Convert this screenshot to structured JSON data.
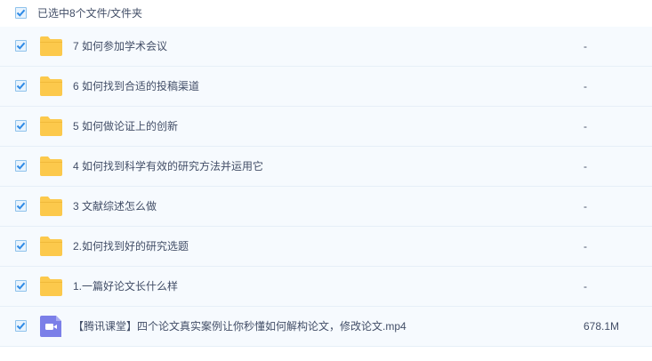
{
  "header": {
    "label": "已选中8个文件/文件夹",
    "checked": true
  },
  "items": [
    {
      "type": "folder",
      "name": "7 如何参加学术会议",
      "size": "-",
      "checked": true
    },
    {
      "type": "folder",
      "name": "6 如何找到合适的投稿渠道",
      "size": "-",
      "checked": true
    },
    {
      "type": "folder",
      "name": "5 如何做论证上的创新",
      "size": "-",
      "checked": true
    },
    {
      "type": "folder",
      "name": "4 如何找到科学有效的研究方法并运用它",
      "size": "-",
      "checked": true
    },
    {
      "type": "folder",
      "name": "3 文献综述怎么做",
      "size": "-",
      "checked": true
    },
    {
      "type": "folder",
      "name": "2.如何找到好的研究选题",
      "size": "-",
      "checked": true
    },
    {
      "type": "folder",
      "name": "1.一篇好论文长什么样",
      "size": "-",
      "checked": true
    },
    {
      "type": "video",
      "name": "【腾讯课堂】四个论文真实案例让你秒懂如何解构论文，修改论文.mp4",
      "size": "678.1M",
      "checked": true
    }
  ],
  "colors": {
    "folder": "#fcc94c",
    "video": "#7b7fe8",
    "check": "#2f8be6",
    "row_bg": "#f6fafe"
  }
}
